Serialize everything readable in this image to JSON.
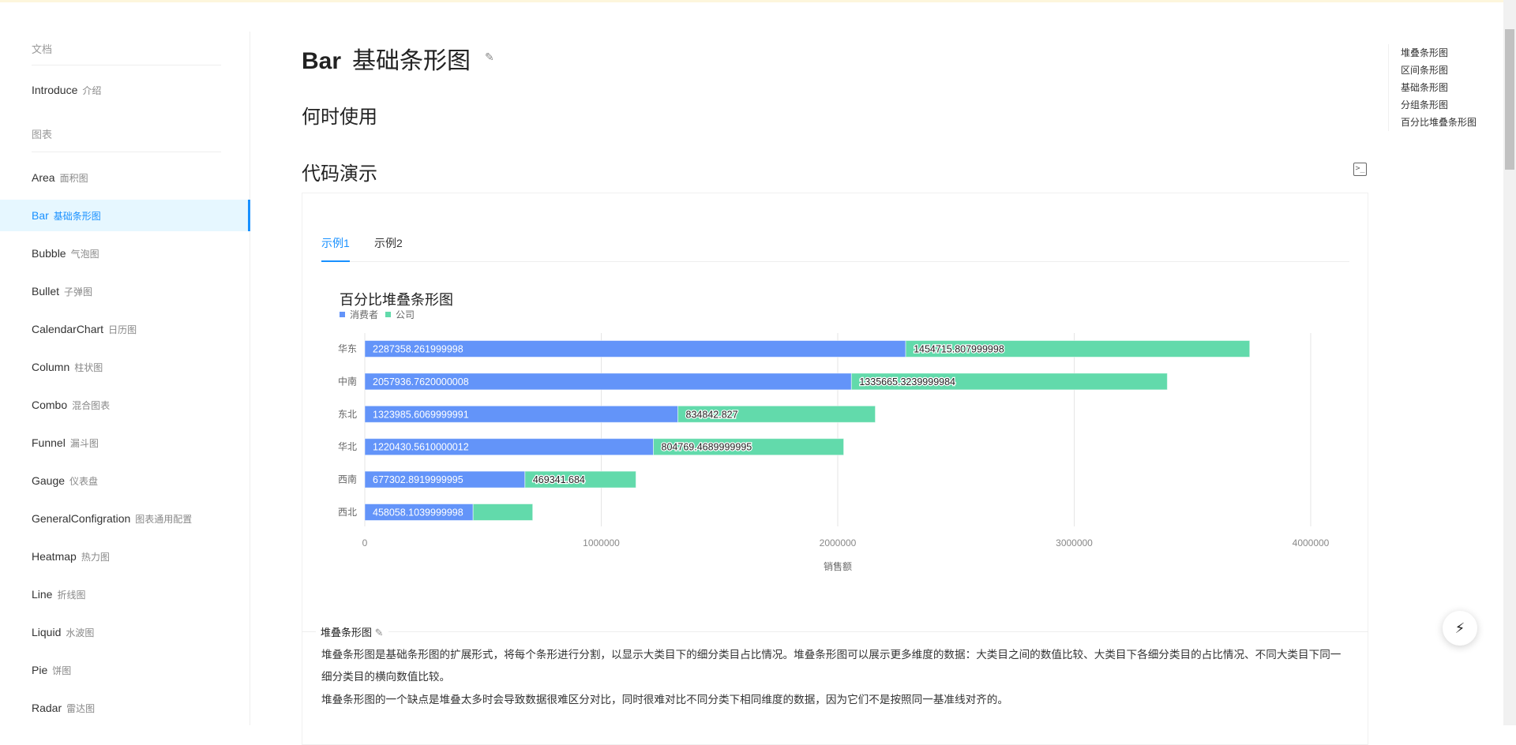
{
  "sidebar": {
    "groups": [
      "文档",
      "图表"
    ],
    "intro": {
      "en": "Introduce",
      "zh": "介绍"
    },
    "items": [
      {
        "en": "Area",
        "zh": "面积图"
      },
      {
        "en": "Bar",
        "zh": "基础条形图",
        "active": true
      },
      {
        "en": "Bubble",
        "zh": "气泡图"
      },
      {
        "en": "Bullet",
        "zh": "子弹图"
      },
      {
        "en": "CalendarChart",
        "zh": "日历图"
      },
      {
        "en": "Column",
        "zh": "柱状图"
      },
      {
        "en": "Combo",
        "zh": "混合图表"
      },
      {
        "en": "Funnel",
        "zh": "漏斗图"
      },
      {
        "en": "Gauge",
        "zh": "仪表盘"
      },
      {
        "en": "GeneralConfigration",
        "zh": "图表通用配置"
      },
      {
        "en": "Heatmap",
        "zh": "热力图"
      },
      {
        "en": "Line",
        "zh": "折线图"
      },
      {
        "en": "Liquid",
        "zh": "水波图"
      },
      {
        "en": "Pie",
        "zh": "饼图"
      },
      {
        "en": "Radar",
        "zh": "雷达图"
      }
    ]
  },
  "page": {
    "title_en": "Bar",
    "title_zh": "基础条形图",
    "when_to_use": "何时使用",
    "demo": "代码演示",
    "tabs": [
      "示例1",
      "示例2"
    ],
    "section_title": "堆叠条形图",
    "paragraphs": [
      "堆叠条形图是基础条形图的扩展形式，将每个条形进行分割，以显示大类目下的细分类目占比情况。堆叠条形图可以展示更多维度的数据：大类目之间的数值比较、大类目下各细分类目的占比情况、不同大类目下同一细分类目的横向数值比较。",
      "堆叠条形图的一个缺点是堆叠太多时会导致数据很难区分对比，同时很难对比不同分类下相同维度的数据，因为它们不是按照同一基准线对齐的。"
    ]
  },
  "toc": [
    "堆叠条形图",
    "区间条形图",
    "基础条形图",
    "分组条形图",
    "百分比堆叠条形图"
  ],
  "colors": {
    "accent": "#1890ff",
    "consumer": "#6394f9",
    "company": "#62daab"
  },
  "chart_data": {
    "type": "bar",
    "orientation": "horizontal",
    "stacked": true,
    "title": "百分比堆叠条形图",
    "xlabel": "销售额",
    "ylabel": "",
    "xlim": [
      0,
      4000000
    ],
    "xticks": [
      "0",
      "1000000",
      "2000000",
      "3000000",
      "4000000"
    ],
    "legend": {
      "position": "top-left",
      "entries": [
        "消费者",
        "公司"
      ]
    },
    "grid": true,
    "categories": [
      "华东",
      "中南",
      "东北",
      "华北",
      "西南",
      "西北"
    ],
    "series": [
      {
        "name": "消费者",
        "values": [
          2287358.261999998,
          2057936.7620000008,
          1323985.6069999991,
          1220430.5610000012,
          677302.8919999995,
          458058.1039999998
        ],
        "labels": [
          "2287358.261999998",
          "2057936.7620000008",
          "1323985.6069999991",
          "1220430.5610000012",
          "677302.8919999995",
          "458058.1039999998"
        ]
      },
      {
        "name": "公司",
        "values": [
          1454715.807999998,
          1335665.3239999984,
          834842.827,
          804769.4689999995,
          469341.684,
          252000
        ],
        "labels": [
          "1454715.807999998",
          "1335665.3239999984",
          "834842.827",
          "804769.4689999995",
          "469341.684",
          ""
        ]
      }
    ]
  }
}
